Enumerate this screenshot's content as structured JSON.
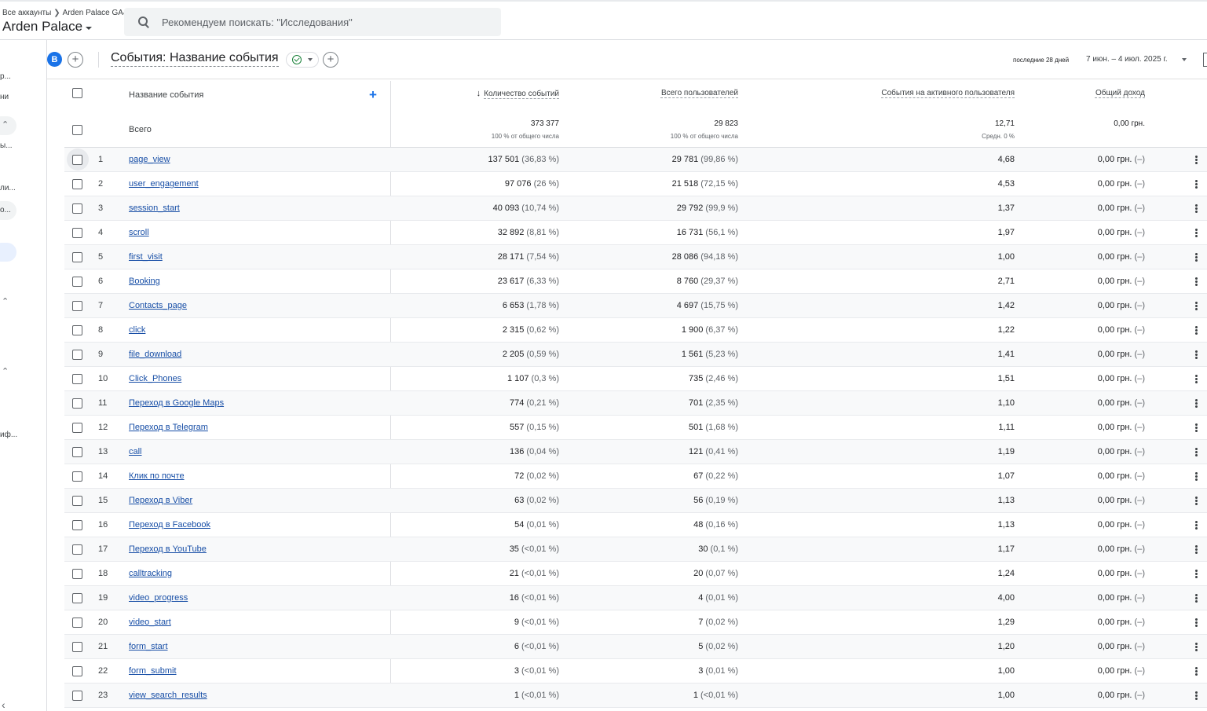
{
  "header": {
    "breadcrumb": [
      "Все аккаунты",
      "Arden Palace GA4"
    ],
    "account_title": "Arden Palace",
    "search_placeholder": "Рекомендуем поискать: \"Исследования\""
  },
  "leftrail": {
    "items": [
      "р...",
      "ни",
      "ы...",
      "ли...",
      "о...",
      "иф..."
    ]
  },
  "toolbar": {
    "avatar_letter": "B",
    "report_title": "События: Название события",
    "date_label": "последние 28 дней",
    "date_range": "7 июн. – 4 июл. 2025 г."
  },
  "table": {
    "columns": {
      "name": "Название события",
      "event_count": "Количество событий",
      "total_users": "Всего пользователей",
      "per_active_user": "События на активного пользователя",
      "revenue": "Общий доход"
    },
    "totals": {
      "label": "Всего",
      "event_count": "373 377",
      "event_count_sub": "100 % от общего числа",
      "total_users": "29 823",
      "total_users_sub": "100 % от общего числа",
      "per_active_user": "12,71",
      "per_active_user_sub": "Средн. 0 %",
      "revenue": "0,00 грн."
    },
    "rows": [
      {
        "n": "1",
        "name": "page_view",
        "ev": "137 501",
        "evp": "(36,83 %)",
        "us": "29 781",
        "usp": "(99,86 %)",
        "per": "4,68",
        "rev": "0,00 грн.",
        "revp": "(–)"
      },
      {
        "n": "2",
        "name": "user_engagement",
        "ev": "97 076",
        "evp": "(26 %)",
        "us": "21 518",
        "usp": "(72,15 %)",
        "per": "4,53",
        "rev": "0,00 грн.",
        "revp": "(–)"
      },
      {
        "n": "3",
        "name": "session_start",
        "ev": "40 093",
        "evp": "(10,74 %)",
        "us": "29 792",
        "usp": "(99,9 %)",
        "per": "1,37",
        "rev": "0,00 грн.",
        "revp": "(–)"
      },
      {
        "n": "4",
        "name": "scroll",
        "ev": "32 892",
        "evp": "(8,81 %)",
        "us": "16 731",
        "usp": "(56,1 %)",
        "per": "1,97",
        "rev": "0,00 грн.",
        "revp": "(–)"
      },
      {
        "n": "5",
        "name": "first_visit",
        "ev": "28 171",
        "evp": "(7,54 %)",
        "us": "28 086",
        "usp": "(94,18 %)",
        "per": "1,00",
        "rev": "0,00 грн.",
        "revp": "(–)"
      },
      {
        "n": "6",
        "name": "Booking",
        "ev": "23 617",
        "evp": "(6,33 %)",
        "us": "8 760",
        "usp": "(29,37 %)",
        "per": "2,71",
        "rev": "0,00 грн.",
        "revp": "(–)"
      },
      {
        "n": "7",
        "name": "Contacts_page",
        "ev": "6 653",
        "evp": "(1,78 %)",
        "us": "4 697",
        "usp": "(15,75 %)",
        "per": "1,42",
        "rev": "0,00 грн.",
        "revp": "(–)"
      },
      {
        "n": "8",
        "name": "click",
        "ev": "2 315",
        "evp": "(0,62 %)",
        "us": "1 900",
        "usp": "(6,37 %)",
        "per": "1,22",
        "rev": "0,00 грн.",
        "revp": "(–)"
      },
      {
        "n": "9",
        "name": "file_download",
        "ev": "2 205",
        "evp": "(0,59 %)",
        "us": "1 561",
        "usp": "(5,23 %)",
        "per": "1,41",
        "rev": "0,00 грн.",
        "revp": "(–)"
      },
      {
        "n": "10",
        "name": "Click_Phones",
        "ev": "1 107",
        "evp": "(0,3 %)",
        "us": "735",
        "usp": "(2,46 %)",
        "per": "1,51",
        "rev": "0,00 грн.",
        "revp": "(–)"
      },
      {
        "n": "11",
        "name": "Переход в Google Maps",
        "ev": "774",
        "evp": "(0,21 %)",
        "us": "701",
        "usp": "(2,35 %)",
        "per": "1,10",
        "rev": "0,00 грн.",
        "revp": "(–)"
      },
      {
        "n": "12",
        "name": "Переход в Telegram",
        "ev": "557",
        "evp": "(0,15 %)",
        "us": "501",
        "usp": "(1,68 %)",
        "per": "1,11",
        "rev": "0,00 грн.",
        "revp": "(–)"
      },
      {
        "n": "13",
        "name": "call",
        "ev": "136",
        "evp": "(0,04 %)",
        "us": "121",
        "usp": "(0,41 %)",
        "per": "1,19",
        "rev": "0,00 грн.",
        "revp": "(–)"
      },
      {
        "n": "14",
        "name": "Клик по почте",
        "ev": "72",
        "evp": "(0,02 %)",
        "us": "67",
        "usp": "(0,22 %)",
        "per": "1,07",
        "rev": "0,00 грн.",
        "revp": "(–)"
      },
      {
        "n": "15",
        "name": "Переход в Viber",
        "ev": "63",
        "evp": "(0,02 %)",
        "us": "56",
        "usp": "(0,19 %)",
        "per": "1,13",
        "rev": "0,00 грн.",
        "revp": "(–)"
      },
      {
        "n": "16",
        "name": "Переход в Facebook",
        "ev": "54",
        "evp": "(0,01 %)",
        "us": "48",
        "usp": "(0,16 %)",
        "per": "1,13",
        "rev": "0,00 грн.",
        "revp": "(–)"
      },
      {
        "n": "17",
        "name": "Переход в YouTube",
        "ev": "35",
        "evp": "(<0,01 %)",
        "us": "30",
        "usp": "(0,1 %)",
        "per": "1,17",
        "rev": "0,00 грн.",
        "revp": "(–)"
      },
      {
        "n": "18",
        "name": "calltracking",
        "ev": "21",
        "evp": "(<0,01 %)",
        "us": "20",
        "usp": "(0,07 %)",
        "per": "1,24",
        "rev": "0,00 грн.",
        "revp": "(–)"
      },
      {
        "n": "19",
        "name": "video_progress",
        "ev": "16",
        "evp": "(<0,01 %)",
        "us": "4",
        "usp": "(0,01 %)",
        "per": "4,00",
        "rev": "0,00 грн.",
        "revp": "(–)"
      },
      {
        "n": "20",
        "name": "video_start",
        "ev": "9",
        "evp": "(<0,01 %)",
        "us": "7",
        "usp": "(0,02 %)",
        "per": "1,29",
        "rev": "0,00 грн.",
        "revp": "(–)"
      },
      {
        "n": "21",
        "name": "form_start",
        "ev": "6",
        "evp": "(<0,01 %)",
        "us": "5",
        "usp": "(0,02 %)",
        "per": "1,20",
        "rev": "0,00 грн.",
        "revp": "(–)"
      },
      {
        "n": "22",
        "name": "form_submit",
        "ev": "3",
        "evp": "(<0,01 %)",
        "us": "3",
        "usp": "(0,01 %)",
        "per": "1,00",
        "rev": "0,00 грн.",
        "revp": "(–)"
      },
      {
        "n": "23",
        "name": "view_search_results",
        "ev": "1",
        "evp": "(<0,01 %)",
        "us": "1",
        "usp": "(<0,01 %)",
        "per": "1,00",
        "rev": "0,00 грн.",
        "revp": "(–)"
      }
    ]
  }
}
